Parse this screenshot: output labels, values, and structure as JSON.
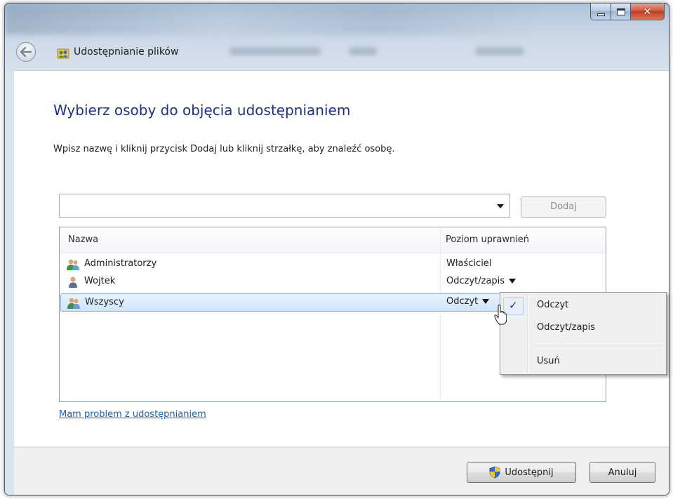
{
  "window": {
    "title": "Udostępnianie plików",
    "caption": {
      "minimize": "minimize",
      "maximize": "maximize",
      "close": "✕"
    }
  },
  "main": {
    "heading": "Wybierz osoby do objęcia udostępnianiem",
    "instructions": "Wpisz nazwę i kliknij przycisk Dodaj lub kliknij strzałkę, aby znaleźć osobę.",
    "name_input": {
      "value": "",
      "placeholder": ""
    },
    "add_button": "Dodaj",
    "list": {
      "columns": [
        "Nazwa",
        "Poziom uprawnień"
      ],
      "rows": [
        {
          "name": "Administratorzy",
          "permission": "Właściciel",
          "has_dropdown": false,
          "icon": "group-icon",
          "selected": false
        },
        {
          "name": "Wojtek",
          "permission": "Odczyt/zapis",
          "has_dropdown": true,
          "icon": "user-icon",
          "selected": false
        },
        {
          "name": "Wszyscy",
          "permission": "Odczyt",
          "has_dropdown": true,
          "icon": "group-icon",
          "selected": true
        }
      ]
    },
    "help_link": "Mam problem z udostępnianiem"
  },
  "permission_menu": {
    "items": [
      {
        "label": "Odczyt",
        "checked": true
      },
      {
        "label": "Odczyt/zapis",
        "checked": false
      },
      {
        "label": "Usuń",
        "checked": false
      }
    ],
    "check_glyph": "✓"
  },
  "footer": {
    "share_button": "Udostępnij",
    "cancel_button": "Anuluj"
  },
  "colors": {
    "heading": "#1e3287",
    "link": "#0a66c2",
    "selection": "#cfe4fb",
    "close_button": "#c13b1e"
  }
}
